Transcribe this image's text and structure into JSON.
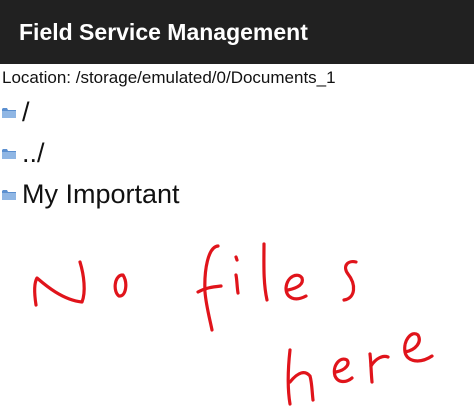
{
  "app_bar": {
    "title": "Field Service Management",
    "background": "#212121"
  },
  "location": {
    "text": "Location: /storage/emulated/0/Documents_1"
  },
  "entries": [
    {
      "label": "/",
      "icon": "folder-icon"
    },
    {
      "label": "../",
      "icon": "folder-icon"
    },
    {
      "label": "My Important",
      "icon": "folder-icon"
    }
  ],
  "annotation": {
    "text": "No files here",
    "color": "#e0141b"
  }
}
